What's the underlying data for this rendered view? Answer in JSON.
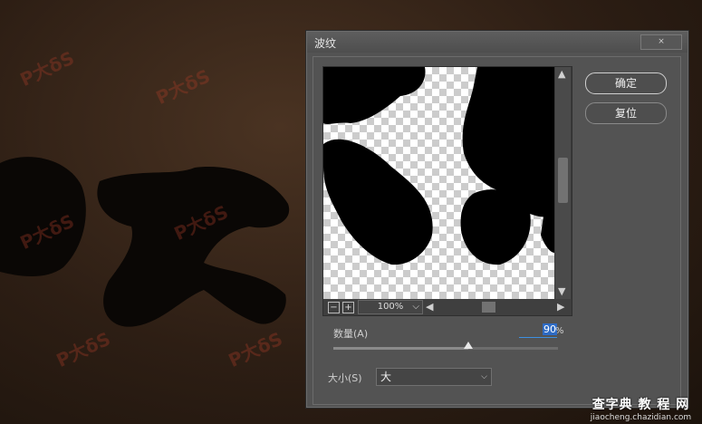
{
  "dialog": {
    "title": "波纹",
    "close_label": "⨯",
    "ok_label": "确定",
    "reset_label": "复位"
  },
  "preview": {
    "zoom_out": "−",
    "zoom_in": "+",
    "zoom_level": "100%",
    "zoom_chevron": "⌵"
  },
  "amount": {
    "label": "数量(A)",
    "value": "90",
    "unit": "%",
    "level": 0.6
  },
  "size": {
    "label": "大小(S)",
    "value": "大"
  },
  "watermark": {
    "main": "查字典 教 程 网",
    "url": "jiaocheng.chazidian.com"
  }
}
